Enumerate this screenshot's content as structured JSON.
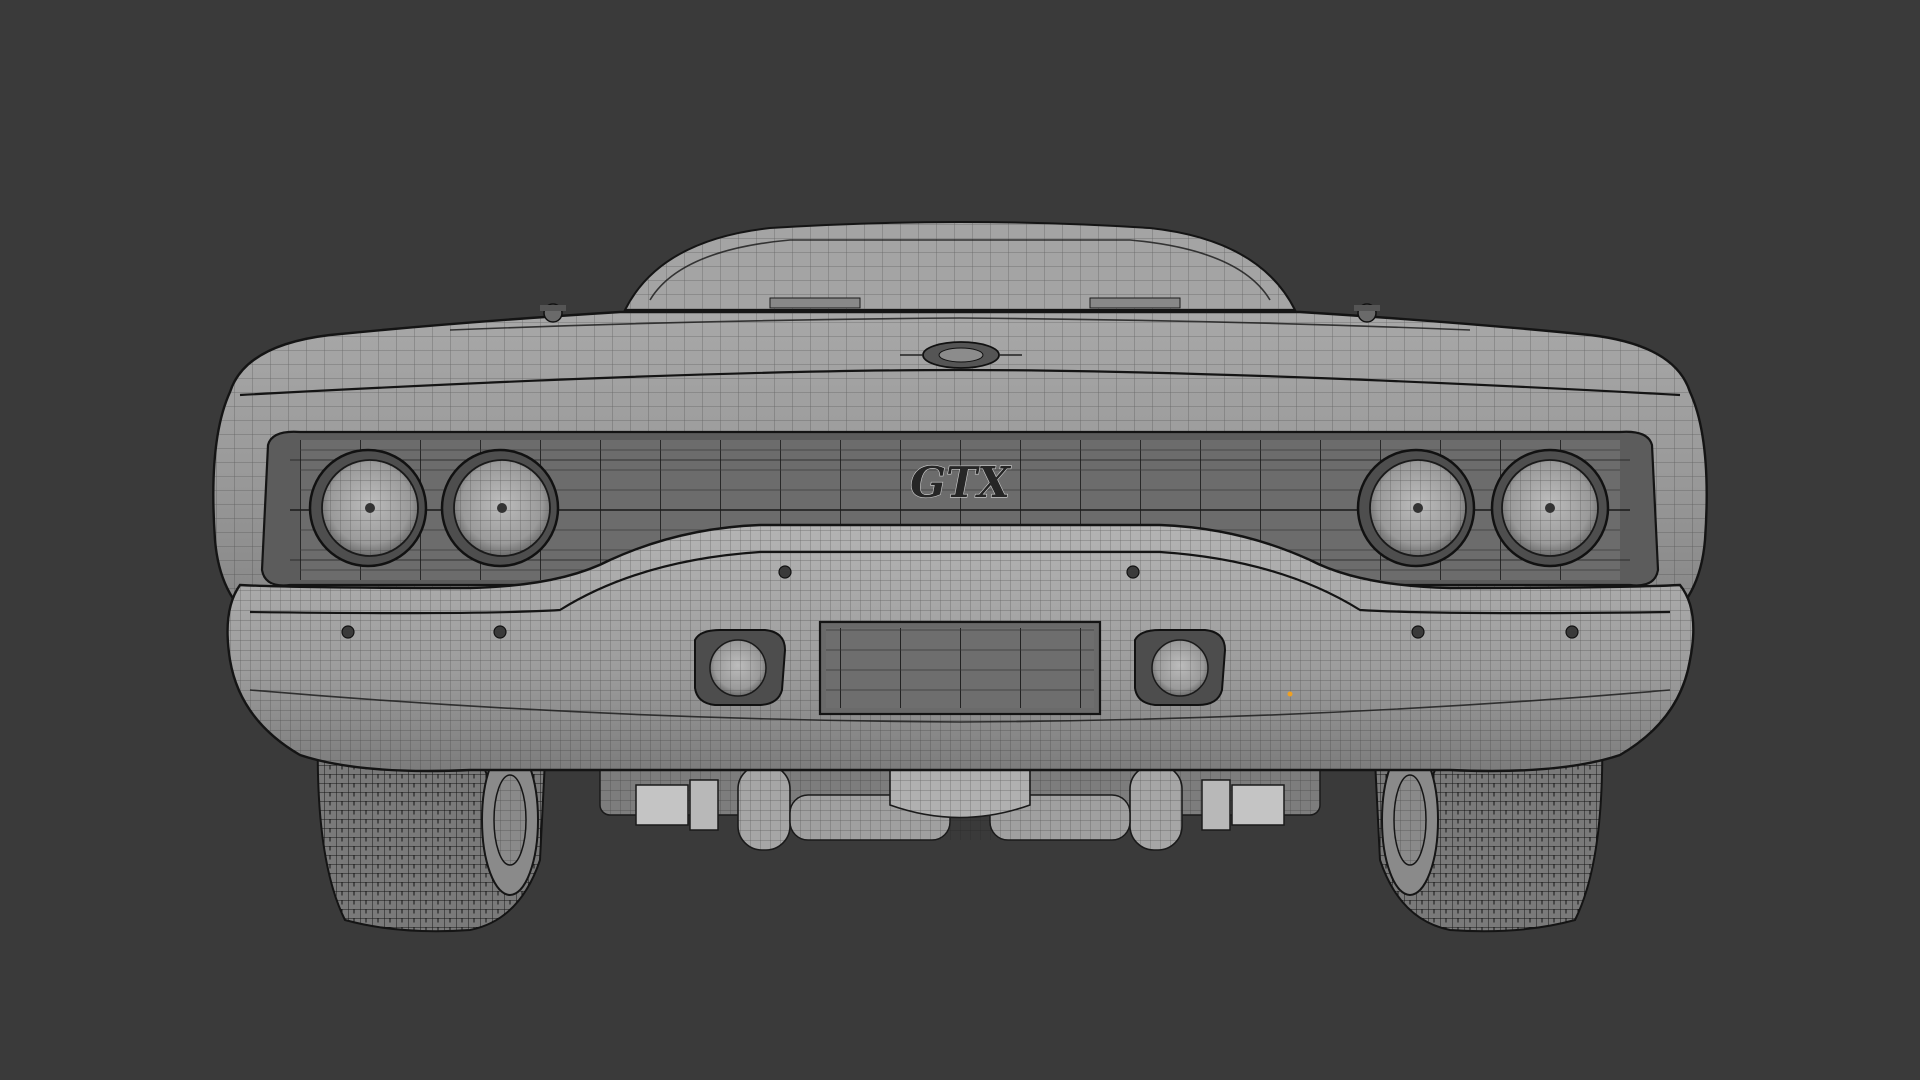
{
  "viewport": {
    "background_color": "#3a3a3a",
    "mesh_color": "#9a9a9a",
    "wire_color": "#1e1e1e"
  },
  "model": {
    "grille_badge": "GTX",
    "selected_vertex_color": "#f0a020"
  }
}
